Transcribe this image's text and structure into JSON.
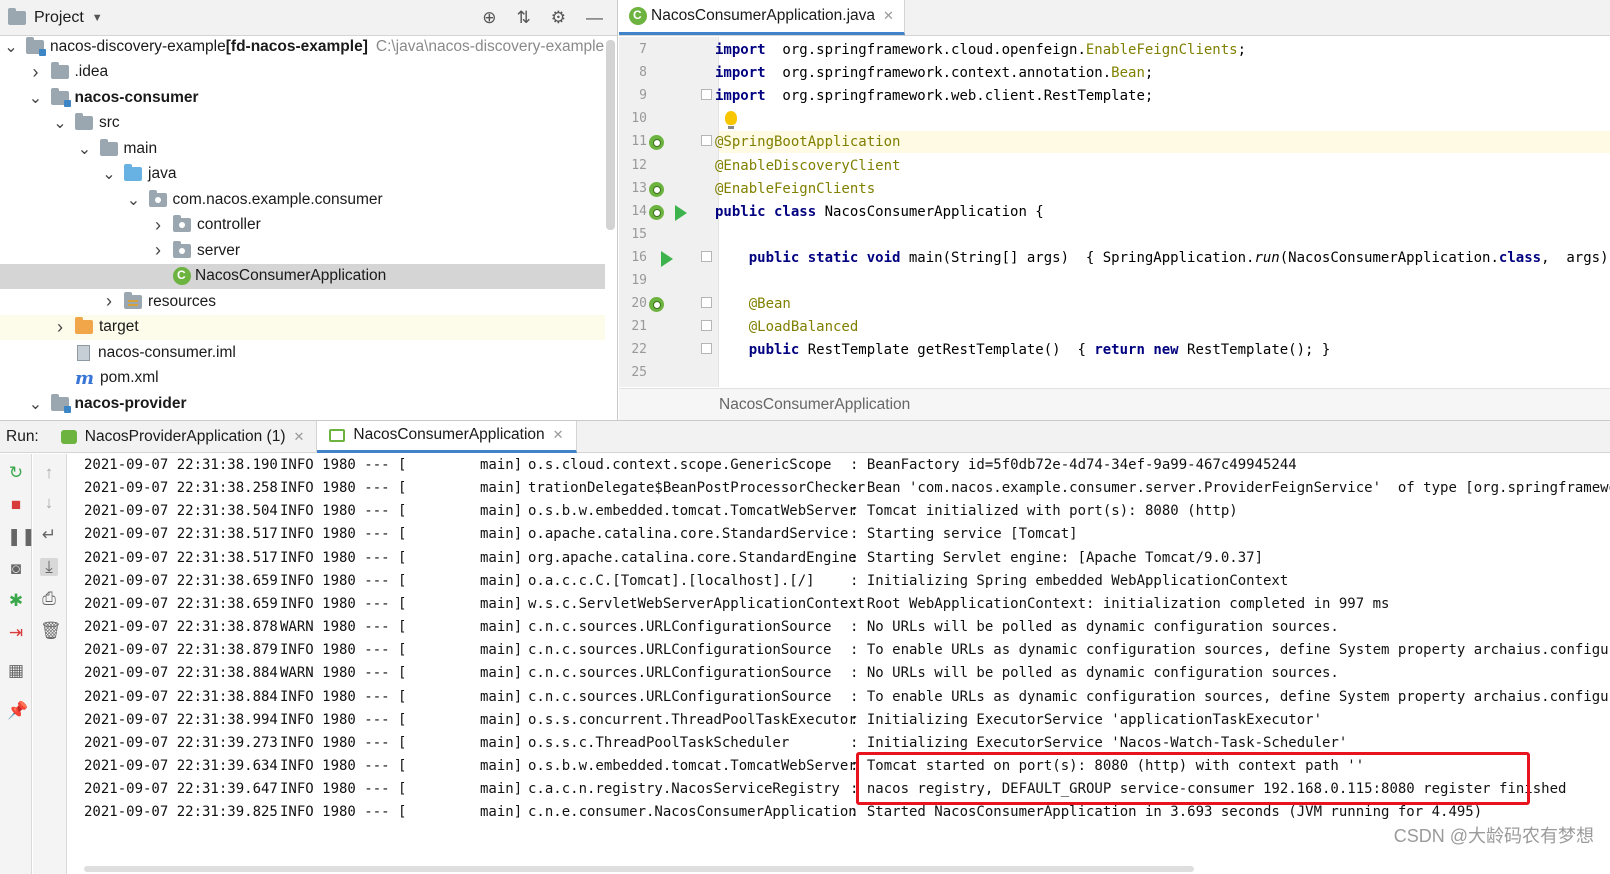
{
  "project": {
    "title": "Project",
    "tree": [
      {
        "label": "nacos-discovery-example",
        "bold_suffix": "[fd-nacos-example]",
        "path": "C:\\java\\nacos-discovery-example",
        "icon": "module-folder",
        "arrow": "down",
        "indent": 0
      },
      {
        "label": ".idea",
        "icon": "folder",
        "arrow": "right",
        "indent": 1
      },
      {
        "label": "nacos-consumer",
        "icon": "module-folder",
        "arrow": "down",
        "indent": 1,
        "bold": true
      },
      {
        "label": "src",
        "icon": "folder",
        "arrow": "down",
        "indent": 2
      },
      {
        "label": "main",
        "icon": "folder",
        "arrow": "down",
        "indent": 3
      },
      {
        "label": "java",
        "icon": "source-folder",
        "arrow": "down",
        "indent": 4
      },
      {
        "label": "com.nacos.example.consumer",
        "icon": "package",
        "arrow": "down",
        "indent": 5
      },
      {
        "label": "controller",
        "icon": "package",
        "arrow": "right",
        "indent": 6
      },
      {
        "label": "server",
        "icon": "package",
        "arrow": "right",
        "indent": 6
      },
      {
        "label": "NacosConsumerApplication",
        "icon": "spring-class",
        "arrow": "none",
        "indent": 6,
        "selected": true
      },
      {
        "label": "resources",
        "icon": "resources-folder",
        "arrow": "right",
        "indent": 4
      },
      {
        "label": "target",
        "icon": "excluded-folder",
        "arrow": "right",
        "indent": 2,
        "excluded": true
      },
      {
        "label": "nacos-consumer.iml",
        "icon": "iml-file",
        "arrow": "none",
        "indent": 2
      },
      {
        "label": "pom.xml",
        "icon": "maven-file",
        "arrow": "none",
        "indent": 2
      },
      {
        "label": "nacos-provider",
        "icon": "module-folder",
        "arrow": "down",
        "indent": 1,
        "bold": true
      }
    ]
  },
  "editor": {
    "tab_label": "NacosConsumerApplication.java",
    "breadcrumb": "NacosConsumerApplication",
    "lines": [
      {
        "n": "7",
        "parts": [
          [
            "kw",
            "import"
          ],
          [
            "",
            "  org.springframework.cloud.openfeign."
          ],
          [
            "ref",
            "EnableFeignClients"
          ],
          [
            "",
            ";"
          ]
        ]
      },
      {
        "n": "8",
        "parts": [
          [
            "kw",
            "import"
          ],
          [
            "",
            "  org.springframework.context.annotation."
          ],
          [
            "ref",
            "Bean"
          ],
          [
            "",
            ";"
          ]
        ]
      },
      {
        "n": "9",
        "parts": [
          [
            "kw",
            "import"
          ],
          [
            "",
            "  org.springframework.web.client.RestTemplate;"
          ]
        ]
      },
      {
        "n": "10",
        "parts": []
      },
      {
        "n": "11",
        "parts": [
          [
            "ann",
            "@SpringBootApplication"
          ]
        ]
      },
      {
        "n": "12",
        "parts": [
          [
            "ann",
            "@EnableDiscoveryClient"
          ]
        ]
      },
      {
        "n": "13",
        "parts": [
          [
            "ann",
            "@EnableFeignClients"
          ]
        ]
      },
      {
        "n": "14",
        "parts": [
          [
            "kw",
            "public class"
          ],
          [
            "",
            " NacosConsumerApplication {"
          ]
        ]
      },
      {
        "n": "15",
        "parts": []
      },
      {
        "n": "16",
        "parts": [
          [
            "",
            "    "
          ],
          [
            "kw",
            "public static void"
          ],
          [
            "",
            " main(String[] args)  { SpringApplication."
          ],
          [
            "it",
            "run"
          ],
          [
            "",
            "(NacosConsumerApplication."
          ],
          [
            "kw",
            "class"
          ],
          [
            "",
            ",  args); }"
          ]
        ]
      },
      {
        "n": "19",
        "parts": []
      },
      {
        "n": "20",
        "parts": [
          [
            "",
            "    "
          ],
          [
            "ann",
            "@Bean"
          ]
        ]
      },
      {
        "n": "21",
        "parts": [
          [
            "",
            "    "
          ],
          [
            "ann",
            "@LoadBalanced"
          ]
        ]
      },
      {
        "n": "22",
        "parts": [
          [
            "",
            "    "
          ],
          [
            "kw",
            "public"
          ],
          [
            "",
            " RestTemplate getRestTemplate()  { "
          ],
          [
            "kw",
            "return new"
          ],
          [
            "",
            " RestTemplate(); }"
          ]
        ]
      },
      {
        "n": "25",
        "parts": []
      }
    ]
  },
  "run": {
    "label": "Run:",
    "tabs": [
      {
        "label": "NacosProviderApplication (1)",
        "active": false
      },
      {
        "label": "NacosConsumerApplication",
        "active": true
      }
    ],
    "log": [
      {
        "time": "2021-09-07 22:31:38.190",
        "level": "INFO 1980 --- [",
        "thread": "main]",
        "logger": "o.s.cloud.context.scope.GenericScope",
        "msg": ": BeanFactory id=5f0db72e-4d74-34ef-9a99-467c49945244"
      },
      {
        "time": "2021-09-07 22:31:38.258",
        "level": "INFO 1980 --- [",
        "thread": "main]",
        "logger": "trationDelegate$BeanPostProcessorChecker",
        "msg": ": Bean 'com.nacos.example.consumer.server.ProviderFeignService'  of type [org.springframework."
      },
      {
        "time": "2021-09-07 22:31:38.504",
        "level": "INFO 1980 --- [",
        "thread": "main]",
        "logger": "o.s.b.w.embedded.tomcat.TomcatWebServer",
        "msg": ": Tomcat initialized with port(s): 8080 (http)"
      },
      {
        "time": "2021-09-07 22:31:38.517",
        "level": "INFO 1980 --- [",
        "thread": "main]",
        "logger": "o.apache.catalina.core.StandardService",
        "msg": ": Starting service [Tomcat]"
      },
      {
        "time": "2021-09-07 22:31:38.517",
        "level": "INFO 1980 --- [",
        "thread": "main]",
        "logger": "org.apache.catalina.core.StandardEngine",
        "msg": ": Starting Servlet engine: [Apache Tomcat/9.0.37]"
      },
      {
        "time": "2021-09-07 22:31:38.659",
        "level": "INFO 1980 --- [",
        "thread": "main]",
        "logger": "o.a.c.c.C.[Tomcat].[localhost].[/]",
        "msg": ": Initializing Spring embedded WebApplicationContext"
      },
      {
        "time": "2021-09-07 22:31:38.659",
        "level": "INFO 1980 --- [",
        "thread": "main]",
        "logger": "w.s.c.ServletWebServerApplicationContext",
        "msg": ": Root WebApplicationContext: initialization completed in 997 ms"
      },
      {
        "time": "2021-09-07 22:31:38.878",
        "level": "WARN 1980 --- [",
        "thread": "main]",
        "logger": "c.n.c.sources.URLConfigurationSource",
        "msg": ": No URLs will be polled as dynamic configuration sources."
      },
      {
        "time": "2021-09-07 22:31:38.879",
        "level": "INFO 1980 --- [",
        "thread": "main]",
        "logger": "c.n.c.sources.URLConfigurationSource",
        "msg": ": To enable URLs as dynamic configuration sources, define System property archaius.configura"
      },
      {
        "time": "2021-09-07 22:31:38.884",
        "level": "WARN 1980 --- [",
        "thread": "main]",
        "logger": "c.n.c.sources.URLConfigurationSource",
        "msg": ": No URLs will be polled as dynamic configuration sources."
      },
      {
        "time": "2021-09-07 22:31:38.884",
        "level": "INFO 1980 --- [",
        "thread": "main]",
        "logger": "c.n.c.sources.URLConfigurationSource",
        "msg": ": To enable URLs as dynamic configuration sources, define System property archaius.configura"
      },
      {
        "time": "2021-09-07 22:31:38.994",
        "level": "INFO 1980 --- [",
        "thread": "main]",
        "logger": "o.s.s.concurrent.ThreadPoolTaskExecutor",
        "msg": ": Initializing ExecutorService 'applicationTaskExecutor'"
      },
      {
        "time": "2021-09-07 22:31:39.273",
        "level": "INFO 1980 --- [",
        "thread": "main]",
        "logger": "o.s.s.c.ThreadPoolTaskScheduler",
        "msg": ": Initializing ExecutorService 'Nacos-Watch-Task-Scheduler'"
      },
      {
        "time": "2021-09-07 22:31:39.634",
        "level": "INFO 1980 --- [",
        "thread": "main]",
        "logger": "o.s.b.w.embedded.tomcat.TomcatWebServer",
        "msg": ": Tomcat started on port(s): 8080 (http) with context path ''"
      },
      {
        "time": "2021-09-07 22:31:39.647",
        "level": "INFO 1980 --- [",
        "thread": "main]",
        "logger": "c.a.c.n.registry.NacosServiceRegistry",
        "msg": ": nacos registry, DEFAULT_GROUP service-consumer 192.168.0.115:8080 register finished"
      },
      {
        "time": "2021-09-07 22:31:39.825",
        "level": "INFO 1980 --- [",
        "thread": "main]",
        "logger": "c.n.e.consumer.NacosConsumerApplication",
        "msg": ": Started NacosConsumerApplication in 3.693 seconds (JVM running for 4.495)"
      }
    ]
  },
  "watermark": "CSDN @大龄码农有梦想",
  "colors": {
    "highlight_box": "#e8131f",
    "tab_underline": "#4083c9",
    "spring_green": "#6db33f"
  }
}
